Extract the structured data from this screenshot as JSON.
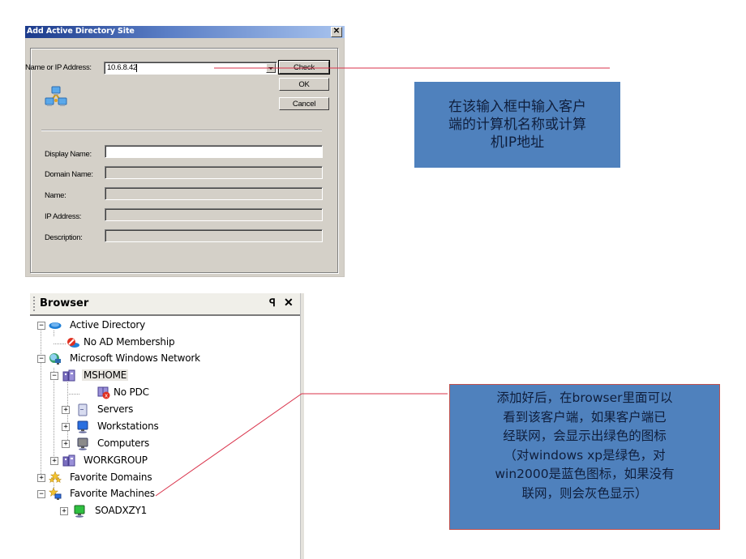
{
  "dialog": {
    "title": "Add Active Directory Site",
    "name_or_ip_label": "Name or IP Address:",
    "name_or_ip_value": "10.6.8.42",
    "buttons": {
      "check": "Check",
      "ok": "OK",
      "cancel": "Cancel"
    },
    "fields": [
      {
        "label": "Display Name:",
        "value": "",
        "enabled": true
      },
      {
        "label": "Domain Name:",
        "value": "",
        "enabled": false
      },
      {
        "label": "Name:",
        "value": "",
        "enabled": false
      },
      {
        "label": "IP Address:",
        "value": "",
        "enabled": false
      },
      {
        "label": "Description:",
        "value": "",
        "enabled": false
      }
    ],
    "icon": "network-computers-icon"
  },
  "browser": {
    "title": "Browser",
    "pin_glyph": "$",
    "close_glyph": "✕",
    "tree": [
      {
        "label": "Active Directory",
        "icon": "active-directory-icon",
        "toggle": "−"
      },
      {
        "label": "No AD Membership",
        "icon": "no-ad-membership-icon",
        "toggle": ""
      },
      {
        "label": "Microsoft Windows Network",
        "icon": "windows-network-icon",
        "toggle": "−"
      },
      {
        "label": "MSHOME",
        "icon": "workgroup-icon",
        "toggle": "−",
        "selected": true
      },
      {
        "label": "No PDC",
        "icon": "no-pdc-icon",
        "toggle": ""
      },
      {
        "label": "Servers",
        "icon": "server-icon",
        "toggle": "+"
      },
      {
        "label": "Workstations",
        "icon": "workstation-icon",
        "toggle": "+"
      },
      {
        "label": "Computers",
        "icon": "computer-icon",
        "toggle": "+"
      },
      {
        "label": "WORKGROUP",
        "icon": "workgroup-icon",
        "toggle": "+"
      },
      {
        "label": "Favorite Domains",
        "icon": "favorite-domains-icon",
        "toggle": "+"
      },
      {
        "label": "Favorite Machines",
        "icon": "favorite-machines-icon",
        "toggle": "−"
      },
      {
        "label": "SOADXZY1",
        "icon": "online-computer-icon",
        "toggle": "+"
      }
    ]
  },
  "callouts": {
    "input_hint": [
      "在该输入框中输入客户",
      "端的计算机名称或计算",
      "机IP地址"
    ],
    "browser_hint": [
      "添加好后，在browser里面可以",
      "看到该客户端，如果客户端已",
      "经联网，会显示出绿色的图标",
      "（对windows xp是绿色，对",
      "win2000是蓝色图标，如果没有",
      "联网，则会灰色显示）"
    ]
  },
  "colors": {
    "callout_fill": "#4f81bd",
    "connector_line": "#d9324a",
    "dialog_face": "#d4d0c8",
    "titlebar_start": "#1c3b8c"
  }
}
